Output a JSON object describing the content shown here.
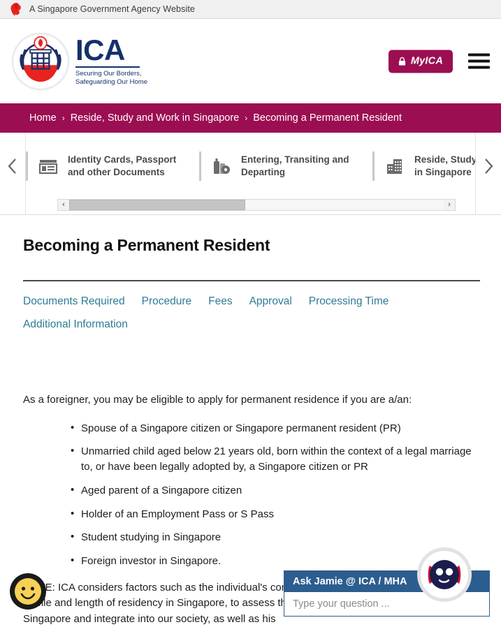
{
  "gov_banner": {
    "text": "A Singapore Government Agency Website",
    "icon": "singapore-lion-head-icon"
  },
  "header": {
    "logo": {
      "crest_icon": "ica-crest-icon",
      "wordmark": "ICA",
      "tagline_line1": "Securing Our Borders,",
      "tagline_line2": "Safeguarding Our Home"
    },
    "myica_button": {
      "label": "MyICA",
      "icon": "lock-icon",
      "color": "#9b0e52"
    },
    "menu_icon": "hamburger-menu-icon"
  },
  "breadcrumb": {
    "separator": "›",
    "items": [
      {
        "label": "Home"
      },
      {
        "label": "Reside, Study and Work in Singapore"
      },
      {
        "label": "Becoming a Permanent Resident"
      }
    ],
    "background": "#9b0e52"
  },
  "carousel": {
    "prev_icon": "chevron-left-icon",
    "next_icon": "chevron-right-icon",
    "items": [
      {
        "label_line1": "Identity Cards, Passport",
        "label_line2": "and other Documents",
        "icon": "id-card-icon"
      },
      {
        "label_line1": "Entering, Transiting and",
        "label_line2": "Departing",
        "icon": "luggage-icon"
      },
      {
        "label_line1": "Reside, Study and Work",
        "label_line2": "in Singapore",
        "icon": "building-icon"
      }
    ],
    "scrollbar": {
      "left_arrow": "‹",
      "right_arrow": "›",
      "thumb_percent": 47
    }
  },
  "main": {
    "title": "Becoming a Permanent Resident",
    "anchor_links": [
      {
        "label": "Documents Required"
      },
      {
        "label": "Procedure"
      },
      {
        "label": "Fees"
      },
      {
        "label": "Approval"
      },
      {
        "label": "Processing Time"
      },
      {
        "label": "Additional Information"
      }
    ],
    "link_color": "#2e7b96",
    "intro": "As a foreigner, you may be eligible to apply for permanent residence if you are a/an:",
    "eligibility": [
      "Spouse of a Singapore citizen or Singapore permanent resident (PR)",
      "Unmarried child aged below 21 years old, born within the context of a legal marriage to, or have been legally adopted by, a Singapore citizen or PR",
      "Aged parent of a Singapore citizen",
      "Holder of an Employment Pass or S Pass",
      "Student studying in Singapore",
      "Foreign investor in Singapore."
    ],
    "note": "NOTE: ICA considers factors such as the individual's contributions, qualifications, age, family profile and length of residency in Singapore, to assess the applicant's ability to contribute to Singapore and integrate into our society, as well as his"
  },
  "feedback": {
    "icon": "smiley-face-icon",
    "face_color": "#f7d154"
  },
  "chatbot": {
    "title": "Ask Jamie @ ICA / MHA",
    "placeholder": "Type your question ...",
    "avatar_icon": "robot-avatar-icon",
    "header_color": "#2c5d8f"
  }
}
